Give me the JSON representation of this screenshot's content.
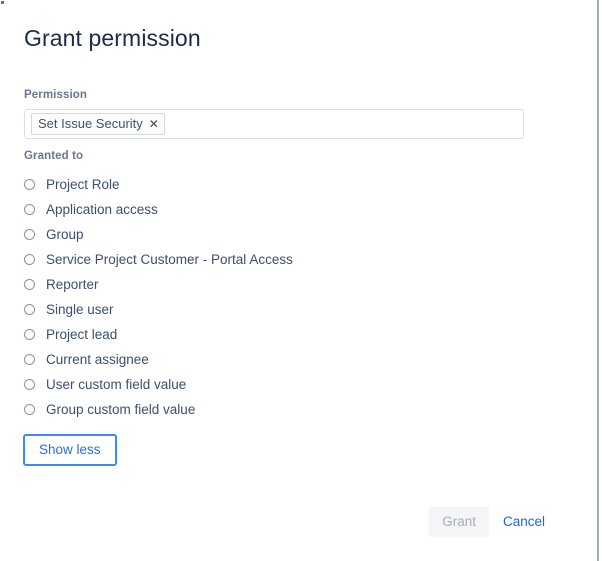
{
  "dialog": {
    "title": "Grant permission"
  },
  "permission": {
    "label": "Permission",
    "chips": [
      {
        "text": "Set Issue Security",
        "remove_icon": "close-icon",
        "remove_glyph": "✕"
      }
    ]
  },
  "granted_to": {
    "label": "Granted to",
    "selected": null,
    "options": [
      {
        "label": "Project Role"
      },
      {
        "label": "Application access"
      },
      {
        "label": "Group"
      },
      {
        "label": "Service Project Customer - Portal Access"
      },
      {
        "label": "Reporter"
      },
      {
        "label": "Single user"
      },
      {
        "label": "Project lead"
      },
      {
        "label": "Current assignee"
      },
      {
        "label": "User custom field value"
      },
      {
        "label": "Group custom field value"
      }
    ]
  },
  "show_less": {
    "label": "Show less"
  },
  "footer": {
    "grant_label": "Grant",
    "grant_disabled": true,
    "cancel_label": "Cancel"
  },
  "colors": {
    "title": "#1c2b4a",
    "label": "#6b778c",
    "option_text": "#3d4f6d",
    "link": "#2563d9",
    "focus_border": "#3d8bf2",
    "disabled_bg": "#f4f5f7",
    "disabled_text": "#a5adba"
  }
}
